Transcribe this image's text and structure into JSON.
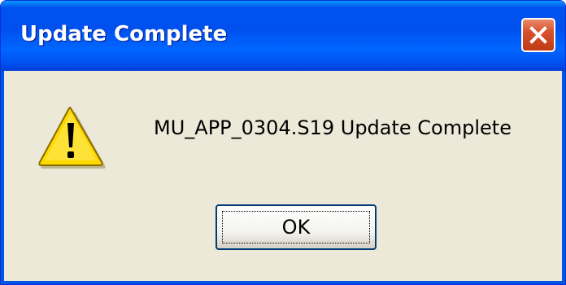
{
  "dialog": {
    "title": "Update Complete",
    "message": "MU_APP_0304.S19 Update Complete",
    "ok_label": "OK",
    "close_icon": "close-icon",
    "message_icon": "warning-icon"
  },
  "colors": {
    "titlebar": "#0053ee",
    "dialog_background": "#ece9d8",
    "close_button": "#d8502c",
    "warning_yellow": "#ffd800"
  }
}
